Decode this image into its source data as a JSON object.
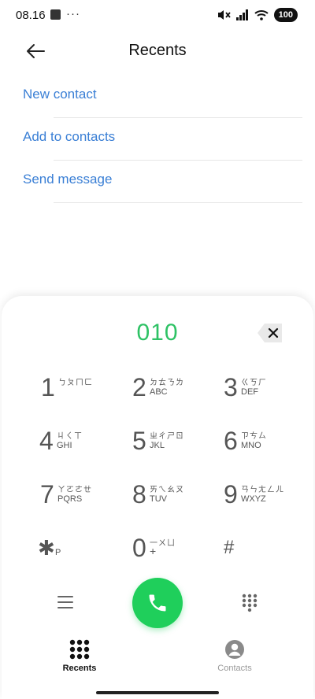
{
  "status_bar": {
    "time": "08.16",
    "dots": "···",
    "battery": "100"
  },
  "header": {
    "title": "Recents"
  },
  "menu": [
    {
      "label": "New contact"
    },
    {
      "label": "Add to contacts"
    },
    {
      "label": "Send message"
    }
  ],
  "dialer": {
    "number": "010",
    "keys": [
      {
        "digit": "1",
        "bopomofo": "ㄅㄆㄇㄈ",
        "letters": ""
      },
      {
        "digit": "2",
        "bopomofo": "ㄉㄊㄋㄌ",
        "letters": "ABC"
      },
      {
        "digit": "3",
        "bopomofo": "ㄍㄎㄏ",
        "letters": "DEF"
      },
      {
        "digit": "4",
        "bopomofo": "ㄐㄑㄒ",
        "letters": "GHI"
      },
      {
        "digit": "5",
        "bopomofo": "ㄓㄔㄕㄖ",
        "letters": "JKL"
      },
      {
        "digit": "6",
        "bopomofo": "ㄗㄘㄙ",
        "letters": "MNO"
      },
      {
        "digit": "7",
        "bopomofo": "ㄚㄛㄜㄝ",
        "letters": "PQRS"
      },
      {
        "digit": "8",
        "bopomofo": "ㄞㄟㄠㄡ",
        "letters": "TUV"
      },
      {
        "digit": "9",
        "bopomofo": "ㄢㄣㄤㄥㄦ",
        "letters": "WXYZ"
      },
      {
        "digit": "✱",
        "bopomofo": "",
        "letters": "P"
      },
      {
        "digit": "0",
        "bopomofo": "一ㄨㄩ",
        "letters": "+"
      },
      {
        "digit": "#",
        "bopomofo": "",
        "letters": ""
      }
    ]
  },
  "nav": {
    "recents": {
      "label": "Recents"
    },
    "contacts": {
      "label": "Contacts"
    }
  },
  "colors": {
    "accent": "#3a7fd5",
    "number": "#2ec265",
    "call": "#1fcf5b"
  }
}
